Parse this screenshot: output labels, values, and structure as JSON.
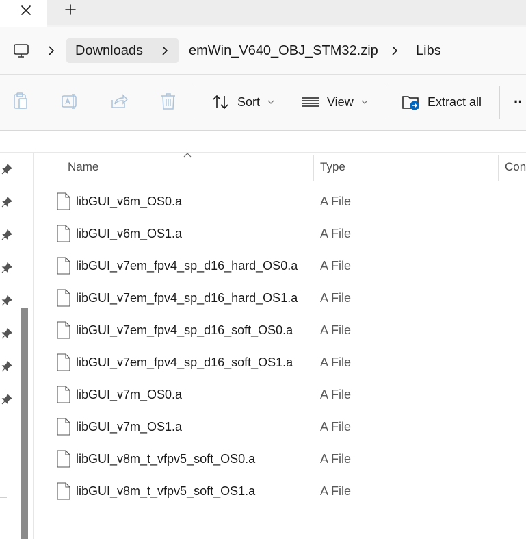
{
  "tabs": {
    "close_symbol": "✕",
    "new_tab_symbol": "+"
  },
  "address": {
    "root_icon": "computer-icon",
    "crumbs": [
      "Downloads",
      "emWin_V640_OBJ_STM32.zip",
      "Libs"
    ],
    "separator": "›"
  },
  "commands": {
    "icons": [
      "clipboard-icon",
      "rename-icon",
      "share-icon",
      "delete-icon"
    ],
    "sort_label": "Sort",
    "view_label": "View",
    "extract_label": "Extract all",
    "more_label": "··"
  },
  "columns": {
    "name": "Name",
    "type": "Type",
    "third": "Con"
  },
  "files": [
    {
      "name": "libGUI_v6m_OS0.a",
      "type": "A File"
    },
    {
      "name": "libGUI_v6m_OS1.a",
      "type": "A File"
    },
    {
      "name": "libGUI_v7em_fpv4_sp_d16_hard_OS0.a",
      "type": "A File"
    },
    {
      "name": "libGUI_v7em_fpv4_sp_d16_hard_OS1.a",
      "type": "A File"
    },
    {
      "name": "libGUI_v7em_fpv4_sp_d16_soft_OS0.a",
      "type": "A File"
    },
    {
      "name": "libGUI_v7em_fpv4_sp_d16_soft_OS1.a",
      "type": "A File"
    },
    {
      "name": "libGUI_v7m_OS0.a",
      "type": "A File"
    },
    {
      "name": "libGUI_v7m_OS1.a",
      "type": "A File"
    },
    {
      "name": "libGUI_v8m_t_vfpv5_soft_OS0.a",
      "type": "A File"
    },
    {
      "name": "libGUI_v8m_t_vfpv5_soft_OS1.a",
      "type": "A File"
    }
  ],
  "colors": {
    "accent": "#0067c0",
    "chrome": "#f9f9f9",
    "tab_strip": "#ededed"
  }
}
